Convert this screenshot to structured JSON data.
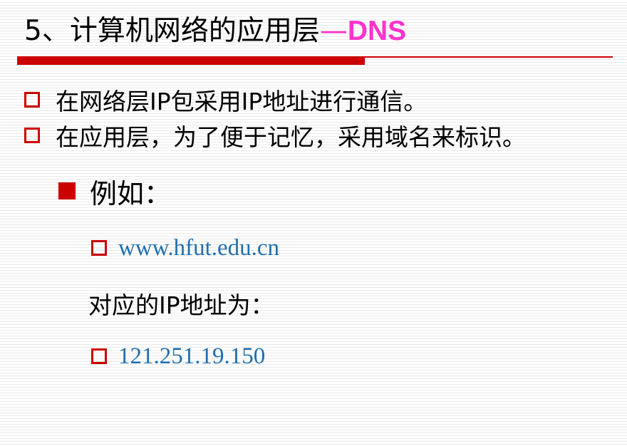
{
  "title": {
    "main": "5、计算机网络的应用层",
    "dash": "—",
    "accent": "DNS"
  },
  "bullets": [
    {
      "text": "在网络层IP包采用IP地址进行通信。"
    },
    {
      "text": "在应用层，为了便于记忆，采用域名来标识。"
    }
  ],
  "example": {
    "heading": "例如：",
    "domain": "www.hfut.edu.cn",
    "ip_label": "对应的IP地址为：",
    "ip": "121.251.19.150"
  },
  "colors": {
    "accent": "#ff33cc",
    "bullet": "#cc0000",
    "link": "#1f6fb0",
    "rule": "#cc0000"
  }
}
